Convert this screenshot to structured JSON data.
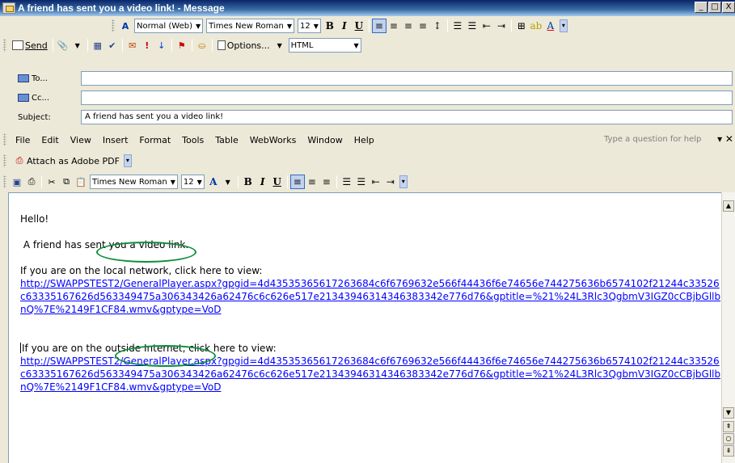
{
  "window": {
    "title": "A friend has sent you a video link! - Message",
    "min": "_",
    "max": "□",
    "close": "X"
  },
  "format_toolbar": {
    "style": "Normal (Web)",
    "font": "Times New Roman",
    "size": "12",
    "bold": "B",
    "italic": "I",
    "underline": "U"
  },
  "send_toolbar": {
    "send": "Send",
    "options": "Options...",
    "format": "HTML"
  },
  "address": {
    "to_label": "To...",
    "to_value": "",
    "cc_label": "Cc...",
    "cc_value": "",
    "subject_label": "Subject:",
    "subject_value": "A friend has sent you a video link!"
  },
  "menu": {
    "items": [
      "File",
      "Edit",
      "View",
      "Insert",
      "Format",
      "Tools",
      "Table",
      "WebWorks",
      "Window",
      "Help"
    ],
    "help_placeholder": "Type a question for help"
  },
  "pdf_toolbar": {
    "attach": "Attach as Adobe PDF"
  },
  "std_toolbar": {
    "font": "Times New Roman",
    "size": "12",
    "bold": "B",
    "italic": "I",
    "underline": "U"
  },
  "message": {
    "greeting": "Hello!",
    "intro": " A friend has sent you a video link.",
    "local_pre": "If you are on ",
    "local_highlight": "the local network",
    "local_post": ", click here to view:",
    "local_link": "http://SWAPPSTEST2/GeneralPlayer.aspx?gpgid=4d43535365617263684c6f6769632e566f44436f6e74656e744275636b6574102f21244c33526c63335167626d563349475a306343426a62476c6c626e517e21343946314346383342e776d76&gptitle=%21%24L3Rlc3QgbmV3IGZ0cCBjbGllbnQ%7E%2149F1CF84.wmv&gptype=VoD",
    "outside_pre": "If you are on the ",
    "outside_highlight": "outside Internet",
    "outside_post": ", click here to view:",
    "outside_link": "http://SWAPPSTEST2/GeneralPlayer.aspx?gpgid=4d43535365617263684c6f6769632e566f44436f6e74656e744275636b6574102f21244c33526c63335167626d563349475a306343426a62476c6c626e517e21343946314346383342e776d76&gptitle=%21%24L3Rlc3QgbmV3IGZ0cCBjbGllbnQ%7E%2149F1CF84.wmv&gptype=VoD"
  },
  "colors": {
    "link": "#0000FF",
    "annotation_circle": "#0E8F3B",
    "titlebar": "#0A246A"
  }
}
